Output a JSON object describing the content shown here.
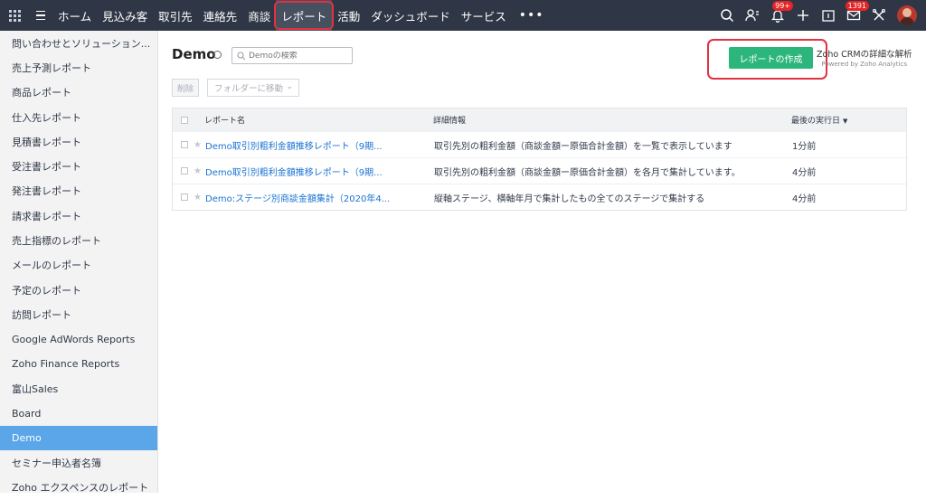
{
  "nav": {
    "tabs": [
      "ホーム",
      "見込み客",
      "取引先",
      "連絡先",
      "商談",
      "レポート",
      "活動",
      "ダッシュボード",
      "サービス"
    ],
    "active_tab": "レポート",
    "more_label": "•••",
    "notifications_badge": "99+",
    "mail_badge": "1391"
  },
  "sidebar": {
    "items": [
      "問い合わせとソリューション...",
      "売上予測レポート",
      "商品レポート",
      "仕入先レポート",
      "見積書レポート",
      "受注書レポート",
      "発注書レポート",
      "請求書レポート",
      "売上指標のレポート",
      "メールのレポート",
      "予定のレポート",
      "訪問レポート",
      "Google AdWords Reports",
      "Zoho Finance Reports",
      "富山Sales",
      "Board",
      "Demo",
      "セミナー申込者名簿",
      "Zoho エクスペンスのレポート"
    ],
    "selected": "Demo"
  },
  "main": {
    "title": "Demo",
    "search_placeholder": "Demoの検索",
    "create_button": "レポートの作成",
    "analytics_line1": "Zoho CRMの詳細な解析",
    "analytics_line2": "Powered by Zoho Analytics",
    "delete_button": "削除",
    "move_button": "フォルダーに移動"
  },
  "table": {
    "headers": [
      "レポート名",
      "詳細情報",
      "最後の実行日"
    ],
    "rows": [
      {
        "name": "Demo取引別粗利金額推移レポート（9期...",
        "detail": "取引先別の粗利金額（商談金額ー原価合計金額）を一覧で表示しています",
        "last_run": "1分前"
      },
      {
        "name": "Demo取引別粗利金額推移レポート（9期...",
        "detail": "取引先別の粗利金額（商談金額ー原価合計金額）を各月で集計しています。",
        "last_run": "4分前"
      },
      {
        "name": "Demo:ステージ別商談金額集計（2020年4...",
        "detail": "縦軸ステージ、横軸年月で集計したもの全てのステージで集計する",
        "last_run": "4分前"
      }
    ]
  }
}
